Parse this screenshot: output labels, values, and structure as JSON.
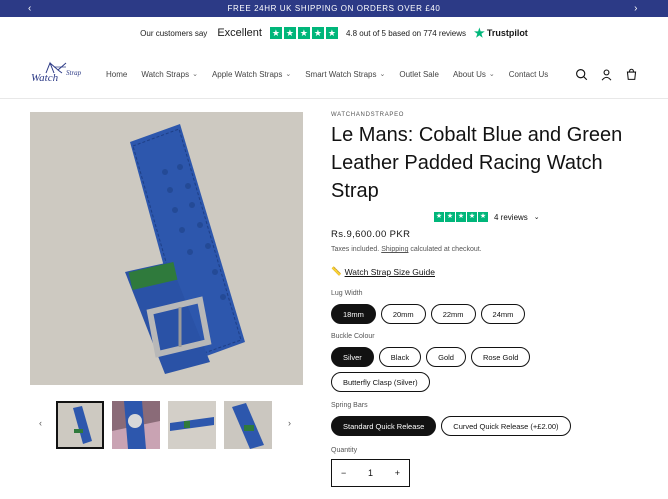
{
  "announcement": {
    "text": "FREE 24HR UK SHIPPING ON ORDERS OVER £40",
    "prev_icon": "‹",
    "next_icon": "›"
  },
  "trustpilot": {
    "customers_say": "Our customers say",
    "rating_word": "Excellent",
    "rating_text": "4.8 out of 5 based on 774 reviews",
    "brand": "Trustpilot",
    "star_color": "#00b67a"
  },
  "header": {
    "logo_text": "Watch",
    "logo_strap": "Strap",
    "nav": [
      {
        "label": "Home",
        "has_dropdown": false
      },
      {
        "label": "Watch Straps",
        "has_dropdown": true
      },
      {
        "label": "Apple Watch Straps",
        "has_dropdown": true
      },
      {
        "label": "Smart Watch Straps",
        "has_dropdown": true
      },
      {
        "label": "Outlet Sale",
        "has_dropdown": false
      },
      {
        "label": "About Us",
        "has_dropdown": true
      },
      {
        "label": "Contact Us",
        "has_dropdown": false
      }
    ],
    "icons": [
      "search-icon",
      "account-icon",
      "cart-icon"
    ]
  },
  "product": {
    "vendor": "WATCHANDSTRAPEO",
    "title": "Le Mans: Cobalt Blue and Green Leather Padded Racing Watch Strap",
    "reviews_text": "4 reviews",
    "price": "Rs.9,600.00 PKR",
    "taxes_prefix": "Taxes included.",
    "taxes_link": "Shipping",
    "taxes_suffix": "calculated at checkout.",
    "size_guide_icon": "📏",
    "size_guide": "Watch Strap Size Guide",
    "lug_width_label": "Lug Width",
    "lug_widths": [
      "18mm",
      "20mm",
      "22mm",
      "24mm"
    ],
    "lug_selected": "18mm",
    "buckle_label": "Buckle Colour",
    "buckles": [
      "Silver",
      "Black",
      "Gold",
      "Rose Gold",
      "Butterfly Clasp (Silver)"
    ],
    "buckle_selected": "Silver",
    "spring_label": "Spring Bars",
    "springs": [
      "Standard Quick Release",
      "Curved Quick Release (+£2.00)"
    ],
    "spring_selected": "Standard Quick Release",
    "quantity_label": "Quantity",
    "quantity": "1",
    "minus": "−",
    "plus": "+",
    "strap_color": "#2d57ad",
    "keeper_color": "#2f7a3c"
  },
  "gallery": {
    "prev_icon": "‹",
    "next_icon": "›",
    "thumb_count": 4
  }
}
